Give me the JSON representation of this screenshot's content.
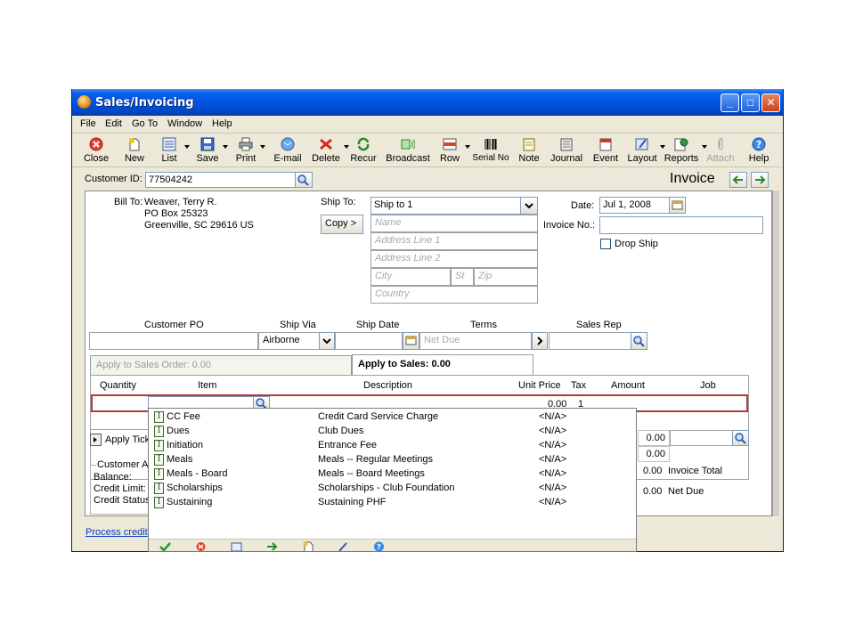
{
  "window": {
    "title": "Sales/Invoicing",
    "minimize": "_",
    "maximize": "□",
    "close": "✕"
  },
  "menu": [
    {
      "label": "File"
    },
    {
      "label": "Edit"
    },
    {
      "label": "Go To"
    },
    {
      "label": "Window"
    },
    {
      "label": "Help"
    }
  ],
  "toolbar": [
    {
      "label": "Close",
      "icon": "close-icon"
    },
    {
      "label": "New",
      "icon": "new-icon"
    },
    {
      "label": "List",
      "icon": "list-icon"
    },
    {
      "label": "Save",
      "icon": "save-icon"
    },
    {
      "label": "Print",
      "icon": "print-icon"
    },
    {
      "label": "E-mail",
      "icon": "email-icon"
    },
    {
      "label": "Delete",
      "icon": "delete-icon"
    },
    {
      "label": "Recur",
      "icon": "recur-icon"
    },
    {
      "label": "Broadcast",
      "icon": "broadcast-icon"
    },
    {
      "label": "Row",
      "icon": "row-icon"
    },
    {
      "label": "Serial No",
      "icon": "barcode-icon"
    },
    {
      "label": "Note",
      "icon": "note-icon"
    },
    {
      "label": "Journal",
      "icon": "journal-icon"
    },
    {
      "label": "Event",
      "icon": "event-icon"
    },
    {
      "label": "Layout",
      "icon": "layout-icon"
    },
    {
      "label": "Reports",
      "icon": "reports-icon"
    },
    {
      "label": "Attach",
      "icon": "attach-icon"
    },
    {
      "label": "Help",
      "icon": "help-icon"
    }
  ],
  "customer": {
    "id_label": "Customer ID:",
    "id_value": "77504242"
  },
  "doc_type": "Invoice",
  "bill_to": {
    "label": "Bill To:",
    "line1": "Weaver, Terry R.",
    "line2": "PO Box 25323",
    "line3": "Greenville, SC 29616 US"
  },
  "ship_to": {
    "label": "Ship To:",
    "selected": "Ship to 1",
    "copy_button": "Copy >",
    "ph_name": "Name",
    "ph_addr1": "Address Line 1",
    "ph_addr2": "Address Line 2",
    "ph_city": "City",
    "ph_state": "St",
    "ph_zip": "Zip",
    "ph_country": "Country"
  },
  "date": {
    "label": "Date:",
    "value": "Jul 1, 2008"
  },
  "invoice_no": {
    "label": "Invoice No.:",
    "value": ""
  },
  "drop_ship": {
    "label": "Drop Ship"
  },
  "header_fields": {
    "customer_po": "Customer PO",
    "ship_via": "Ship Via",
    "ship_via_value": "Airborne",
    "ship_date": "Ship Date",
    "terms": "Terms",
    "terms_ph": "Net Due",
    "sales_rep": "Sales Rep"
  },
  "tabs": {
    "sales_order": "Apply to Sales Order: 0.00",
    "sales": "Apply to Sales: 0.00"
  },
  "grid": {
    "quantity": "Quantity",
    "item": "Item",
    "description": "Description",
    "unit_price": "Unit Price",
    "tax": "Tax",
    "amount": "Amount",
    "job": "Job",
    "row1_unit_price": "0.00",
    "row1_tax": "1"
  },
  "dropdown_items": [
    {
      "item": "CC Fee",
      "description": "Credit Card Service Charge",
      "price": "<N/A>"
    },
    {
      "item": "Dues",
      "description": "Club Dues",
      "price": "<N/A>"
    },
    {
      "item": "Initiation",
      "description": "Entrance Fee",
      "price": "<N/A>"
    },
    {
      "item": "Meals",
      "description": "Meals -- Regular Meetings",
      "price": "<N/A>"
    },
    {
      "item": "Meals - Board",
      "description": "Meals -- Board Meetings",
      "price": "<N/A>"
    },
    {
      "item": "Scholarships",
      "description": "Scholarships - Club Foundation",
      "price": "<N/A>"
    },
    {
      "item": "Sustaining",
      "description": "Sustaining PHF",
      "price": "<N/A>"
    }
  ],
  "totals": {
    "freight": "0.00",
    "other": "0.00",
    "invoice_total_value": "0.00",
    "invoice_total_label": "Invoice Total",
    "net_due_value": "0.00",
    "net_due_label": "Net Due"
  },
  "left_panel": {
    "apply_tickets": "Apply Ticke",
    "customer_acct": "Customer Ac",
    "balance": "Balance:",
    "credit_limit": "Credit Limit:",
    "credit_status": "Credit Status"
  },
  "process_credit": "Process credit",
  "dropdown_tools": [
    "check-icon",
    "cancel-icon",
    "find-icon",
    "next-icon",
    "new-icon",
    "edit-icon",
    "help-icon"
  ]
}
